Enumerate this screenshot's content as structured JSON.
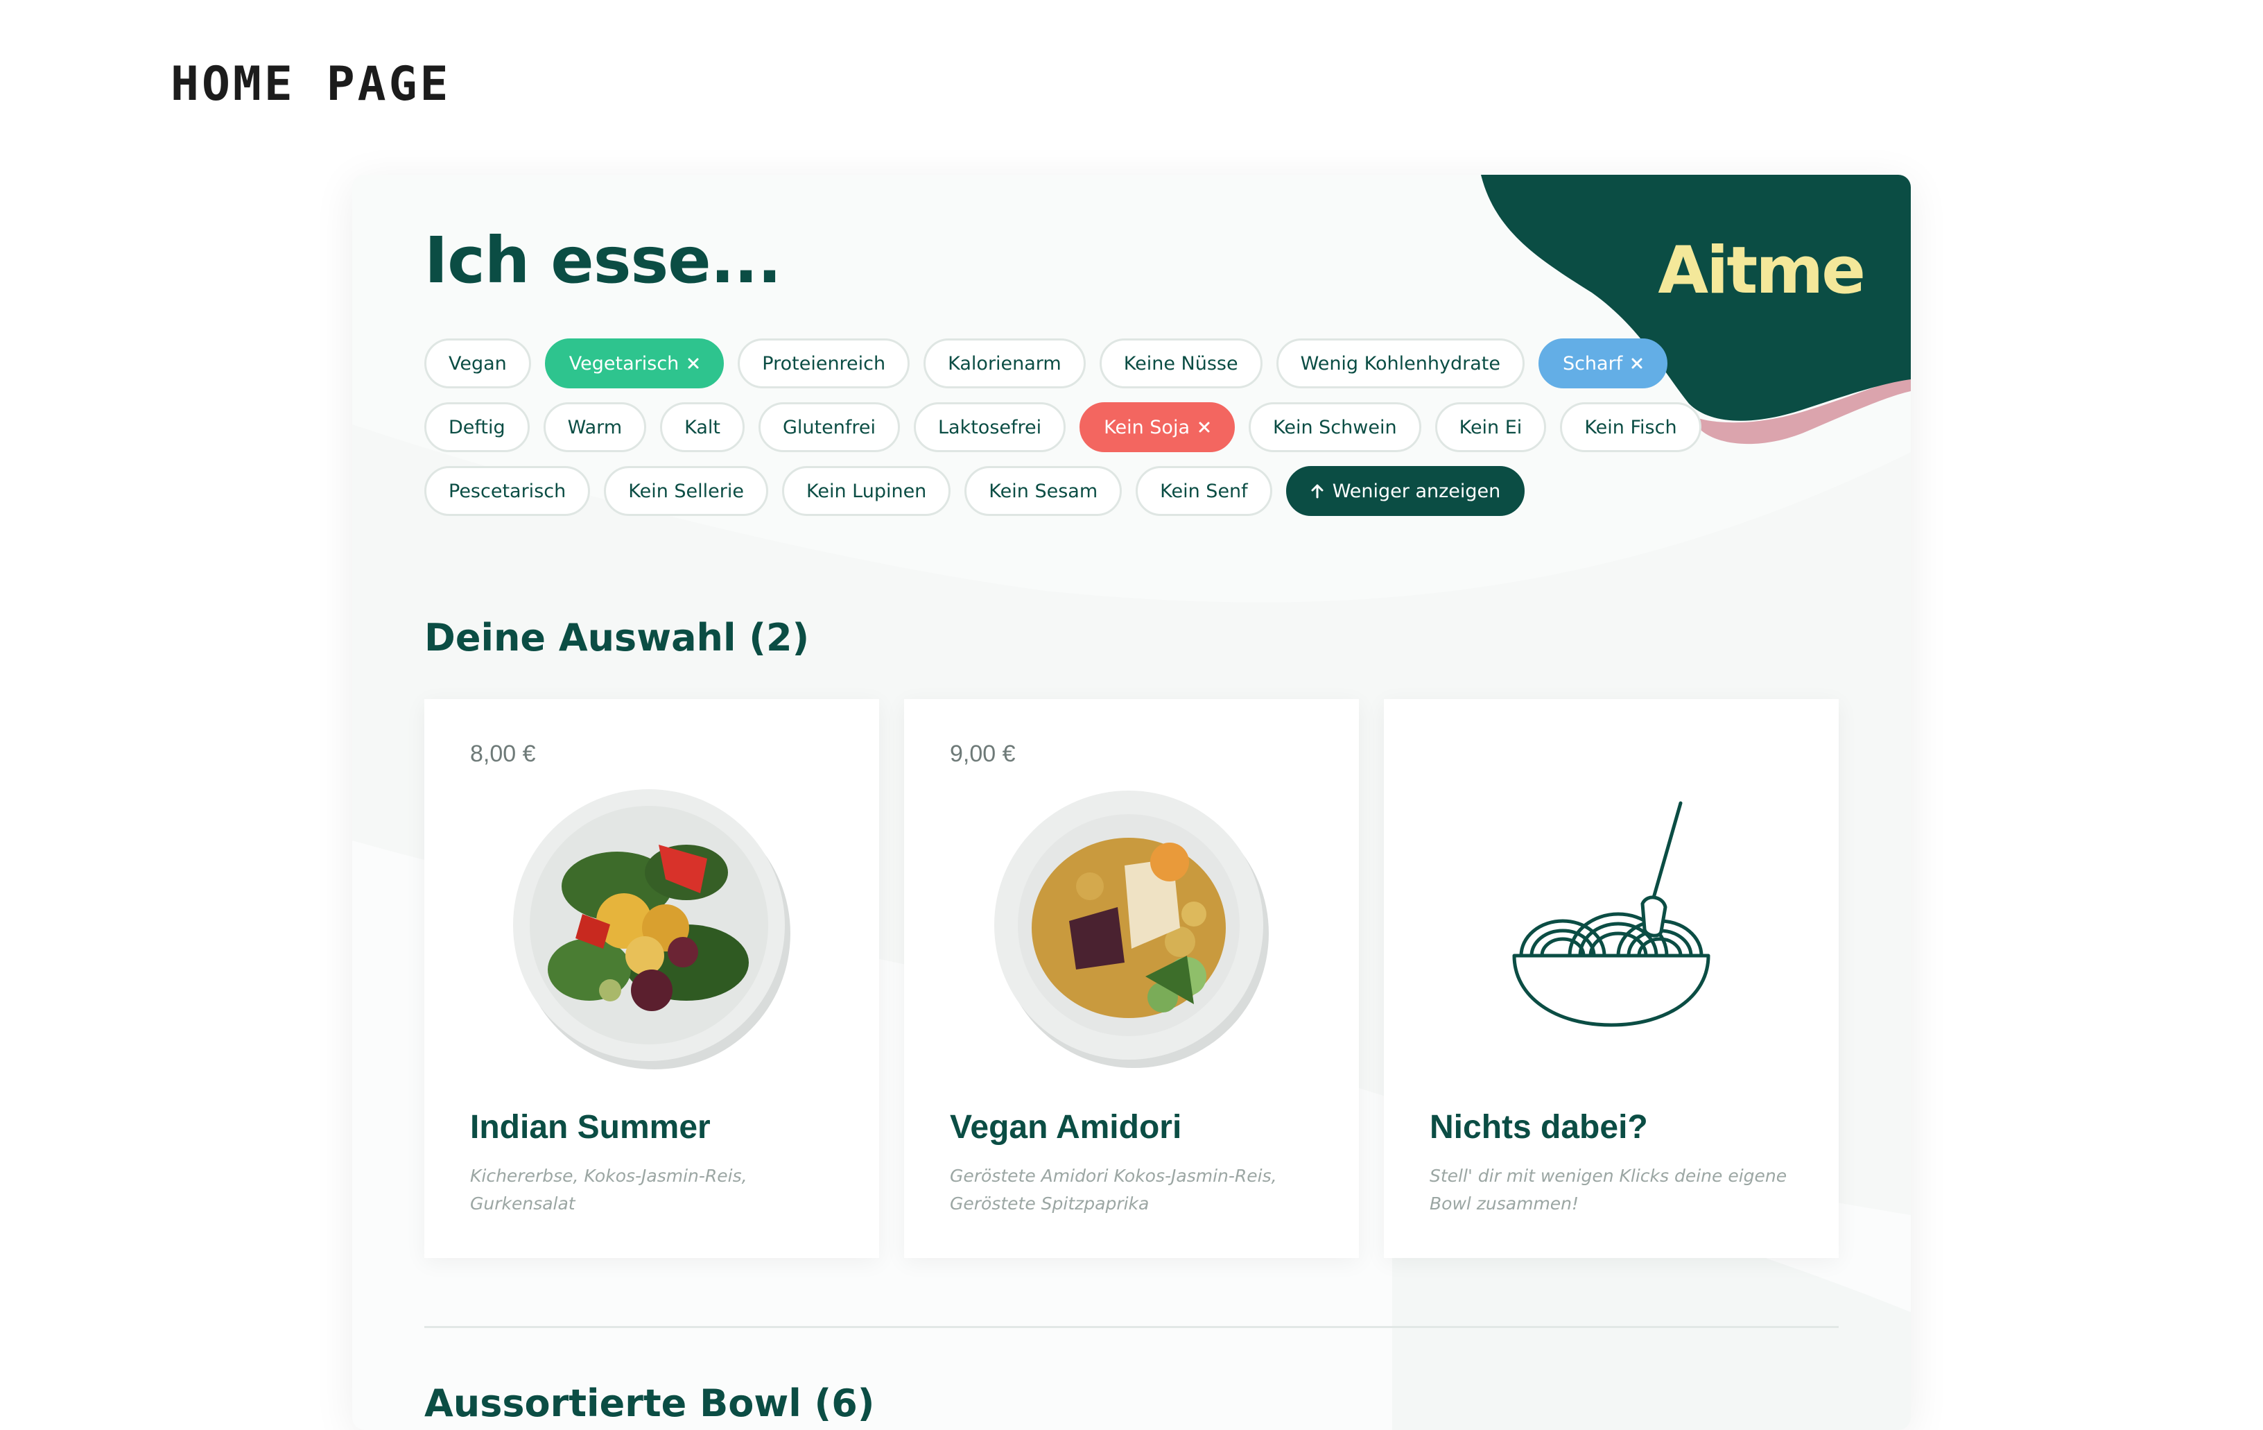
{
  "page_label": "HOME PAGE",
  "brand": {
    "logo": "Aitme",
    "colors": {
      "dark_green": "#0b4d44",
      "yellow": "#f4e89a",
      "pink": "#dba4ad"
    }
  },
  "headline": "Ich esse...",
  "filters": {
    "rows": [
      [
        {
          "label": "Vegan",
          "state": "default"
        },
        {
          "label": "Vegetarisch",
          "state": "selected-green",
          "removable": true
        },
        {
          "label": "Proteienreich",
          "state": "default"
        },
        {
          "label": "Kalorienarm",
          "state": "default"
        },
        {
          "label": "Keine Nüsse",
          "state": "default"
        },
        {
          "label": "Wenig Kohlenhydrate",
          "state": "default"
        },
        {
          "label": "Scharf",
          "state": "selected-blue",
          "removable": true
        }
      ],
      [
        {
          "label": "Deftig",
          "state": "default"
        },
        {
          "label": "Warm",
          "state": "default"
        },
        {
          "label": "Kalt",
          "state": "default"
        },
        {
          "label": "Glutenfrei",
          "state": "default"
        },
        {
          "label": "Laktosefrei",
          "state": "default"
        },
        {
          "label": "Kein Soja",
          "state": "selected-red",
          "removable": true
        },
        {
          "label": "Kein Schwein",
          "state": "default"
        },
        {
          "label": "Kein Ei",
          "state": "default"
        },
        {
          "label": "Kein Fisch",
          "state": "default"
        }
      ],
      [
        {
          "label": "Pescetarisch",
          "state": "default"
        },
        {
          "label": "Kein Sellerie",
          "state": "default"
        },
        {
          "label": "Kein Lupinen",
          "state": "default"
        },
        {
          "label": "Kein Sesam",
          "state": "default"
        },
        {
          "label": "Kein Senf",
          "state": "default"
        }
      ]
    ],
    "show_less_label": "Weniger anzeigen",
    "colors": {
      "green": "#2ec48e",
      "blue": "#63aee6",
      "red": "#f36660"
    }
  },
  "selection": {
    "title": "Deine Auswahl (2)",
    "cards": [
      {
        "price": "8,00 €",
        "title": "Indian Summer",
        "description": "Kichererbse, Kokos-Jasmin-Reis, Gurkensalat",
        "image": "salad-bowl-photo"
      },
      {
        "price": "9,00 €",
        "title": "Vegan Amidori",
        "description": "Geröstete Amidori Kokos-Jasmin-Reis, Geröstete Spitzpaprika",
        "image": "curry-bowl-photo"
      },
      {
        "price": "",
        "title": "Nichts dabei?",
        "description": "Stell' dir mit wenigen Klicks deine eigene Bowl zusammen!",
        "image": "noodle-bowl-icon"
      }
    ]
  },
  "assorted": {
    "title": "Aussortierte Bowl (6)"
  }
}
